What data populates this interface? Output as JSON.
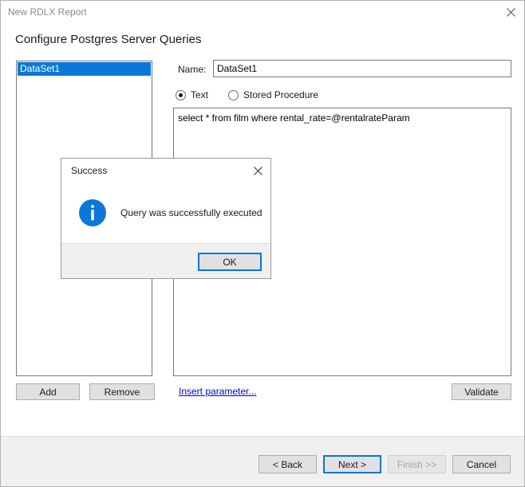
{
  "window": {
    "title": "New RDLX Report",
    "close_icon": "close-icon"
  },
  "page": {
    "heading": "Configure Postgres Server Queries"
  },
  "datasets": {
    "items": [
      {
        "label": "DataSet1",
        "selected": true
      }
    ]
  },
  "form": {
    "name_label": "Name:",
    "name_value": "DataSet1",
    "name_placeholder": "",
    "command_type": [
      {
        "label": "Text",
        "checked": true
      },
      {
        "label": "Stored Procedure",
        "checked": false
      }
    ],
    "query_text": "select * from film where rental_rate=@rentalrateParam"
  },
  "actions": {
    "add_label": "Add",
    "remove_label": "Remove",
    "insert_parameter_label": "Insert parameter...",
    "validate_label": "Validate"
  },
  "footer": {
    "back_label": "< Back",
    "next_label": "Next >",
    "finish_label": "Finish >>",
    "cancel_label": "Cancel"
  },
  "dialog": {
    "title": "Success",
    "message": "Query was successfully executed",
    "ok_label": "OK",
    "close_icon": "close-icon",
    "info_icon": "info-icon"
  },
  "colors": {
    "accent": "#0078d7",
    "selection": "#0b78d7",
    "link": "#0000dd",
    "info_icon": "#0b78d7",
    "chrome": "#f0f0f0"
  }
}
